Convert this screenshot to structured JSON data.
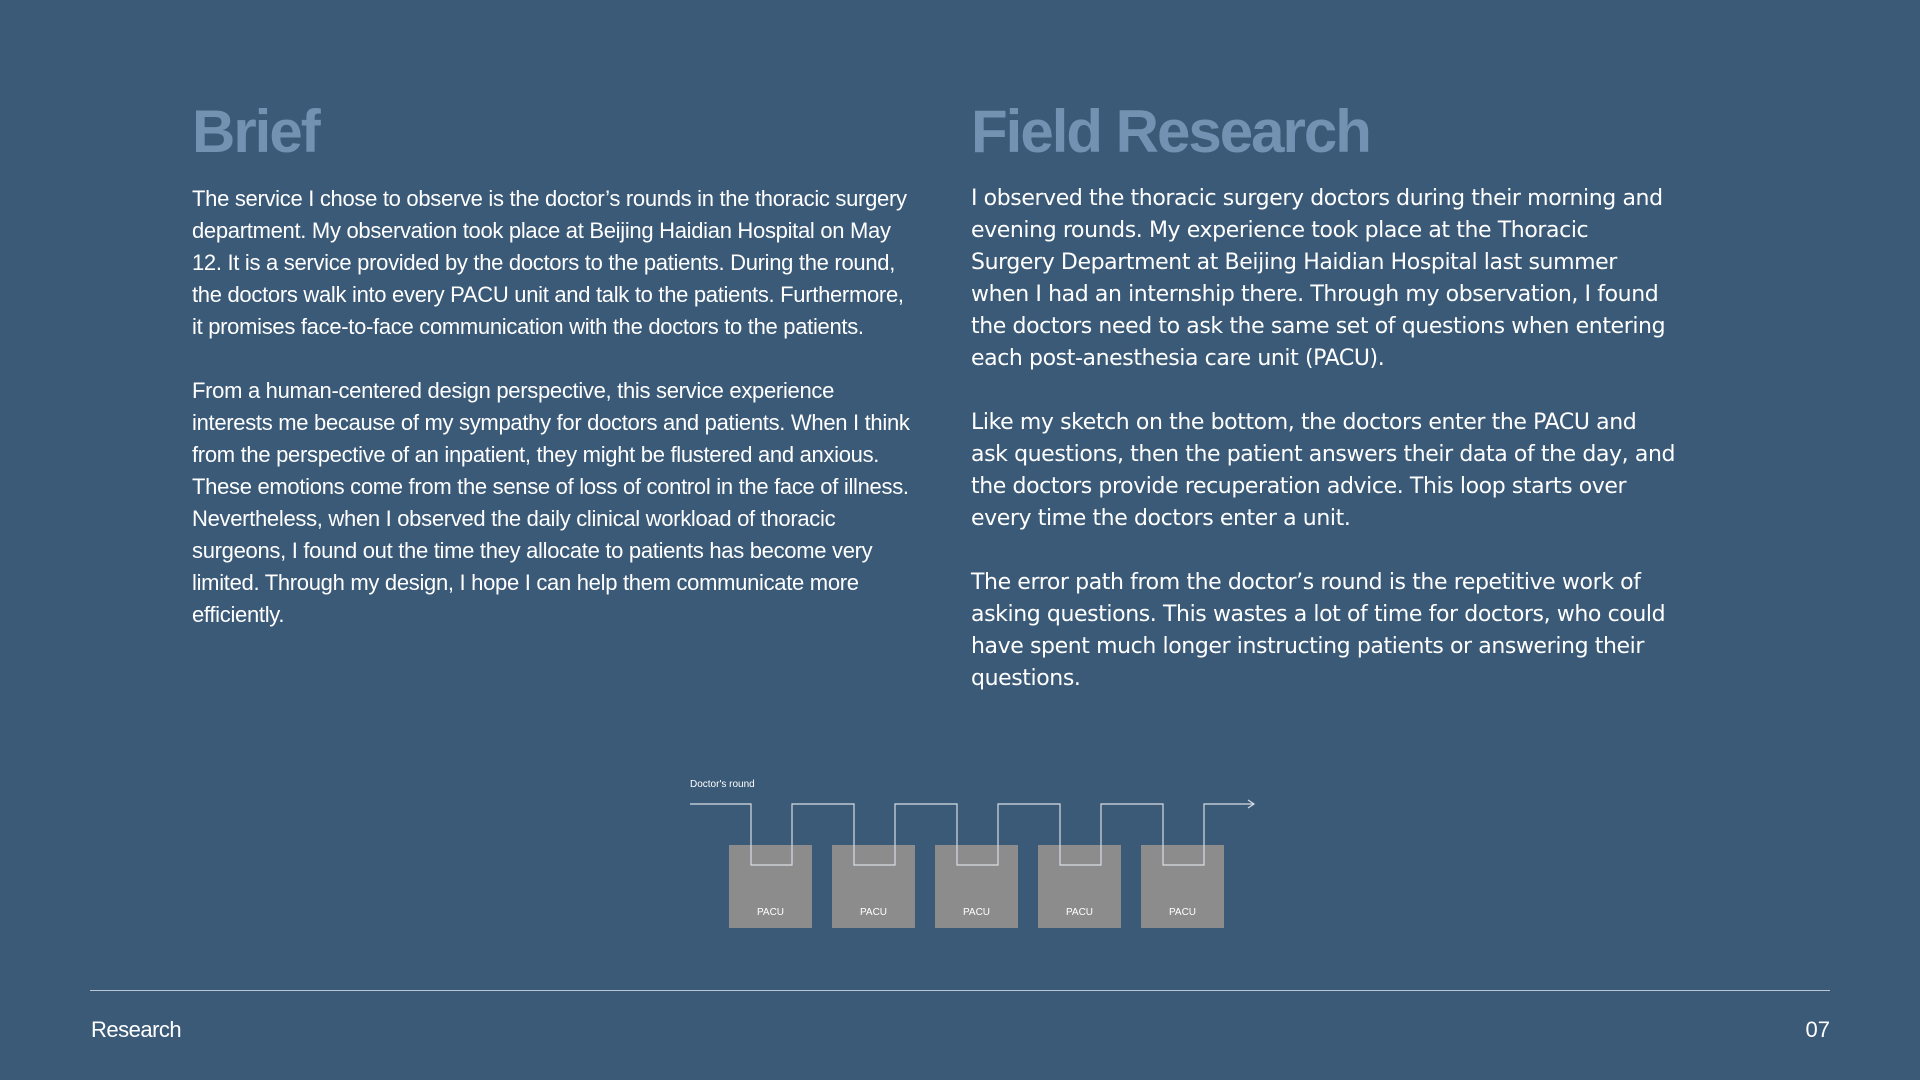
{
  "brief": {
    "title": "Brief",
    "paragraphs": [
      "The service I chose to observe is the doctor’s rounds in the thoracic surgery\ndepartment. My observation took place at Beijing Haidian Hospital on May\n12. It is a service provided by the doctors to the patients. During the round,\nthe doctors walk into every PACU unit and talk to the patients. Furthermore,\nit promises face-to-face communication with the doctors to the patients.",
      "From a human-centered design perspective, this service experience\ninterests me because of my sympathy for doctors and patients. When I think\nfrom the perspective of an inpatient, they might be flustered and anxious.\nThese emotions come from the sense of loss of control in the face of illness.\nNevertheless, when I observed the daily clinical workload of thoracic\nsurgeons, I found out the time they allocate to patients has become very\nlimited. Through my design, I hope I can help them communicate more\nefficiently."
    ]
  },
  "field_research": {
    "title": "Field Research",
    "paragraphs": [
      "I observed the thoracic surgery doctors during their morning and\nevening rounds. My experience took place at the Thoracic\nSurgery Department at Beijing Haidian Hospital last summer\nwhen I had an internship there. Through my observation, I found\nthe doctors need to ask the same set of questions when entering\neach post-anesthesia care unit (PACU).",
      "Like my sketch on the bottom, the doctors enter the PACU and\nask questions, then the patient answers their data of the day, and\nthe doctors provide recuperation advice. This loop starts over\nevery time the doctors enter a unit.",
      "The error path from the doctor’s round is the repetitive work of\nasking questions. This wastes a lot of time for doctors, who could\nhave spent much longer instructing patients or answering their\nquestions."
    ]
  },
  "diagram": {
    "label": "Doctor's round",
    "units": [
      "PACU",
      "PACU",
      "PACU",
      "PACU",
      "PACU"
    ],
    "box_color": "#8c8c8c",
    "line_color": "#d7dde3"
  },
  "footer": {
    "section": "Research",
    "page_number": "07"
  }
}
